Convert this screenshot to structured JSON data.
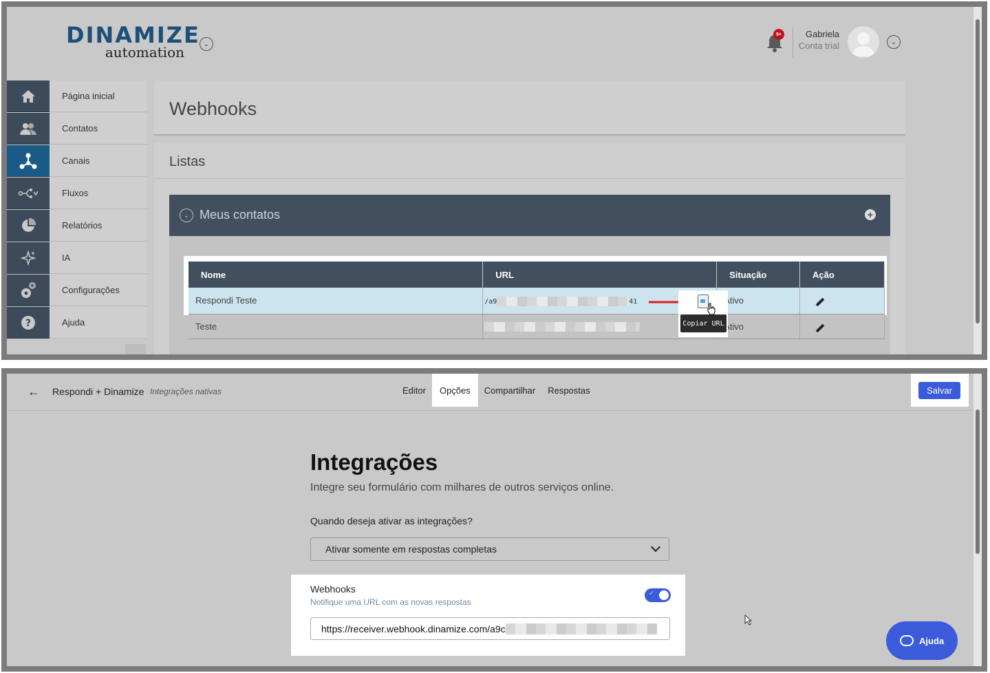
{
  "dinamize": {
    "logo_top": "DINAMIZE",
    "logo_bottom": "automation",
    "notification_badge": "9+",
    "user_name": "Gabriela",
    "user_plan": "Conta trial",
    "sidebar": [
      {
        "label": "Página inicial",
        "icon": "home-icon"
      },
      {
        "label": "Contatos",
        "icon": "contacts-icon"
      },
      {
        "label": "Canais",
        "icon": "channels-icon",
        "active": true
      },
      {
        "label": "Fluxos",
        "icon": "flows-icon"
      },
      {
        "label": "Relatórios",
        "icon": "reports-icon"
      },
      {
        "label": "IA",
        "icon": "ai-icon"
      },
      {
        "label": "Configurações",
        "icon": "settings-icon"
      },
      {
        "label": "Ajuda",
        "icon": "help-icon"
      }
    ],
    "page_title": "Webhooks",
    "section_title": "Listas",
    "group_title": "Meus contatos",
    "table": {
      "headers": [
        "Nome",
        "URL",
        "Situação",
        "Ação"
      ],
      "rows": [
        {
          "name": "Respondi Teste",
          "url_start": "/a9",
          "url_end": "41",
          "status": "Ativo"
        },
        {
          "name": "Teste",
          "url_start": "",
          "url_end": "",
          "status": "Ativo"
        }
      ]
    },
    "tooltip": "Copiar URL"
  },
  "respondi": {
    "title": "Respondi + Dinamize",
    "subtitle": "Integrações nativas",
    "tabs": [
      "Editor",
      "Opções",
      "Compartilhar",
      "Respostas"
    ],
    "active_tab": "Opções",
    "save_label": "Salvar",
    "heading": "Integrações",
    "description": "Integre seu formulário com milhares de outros serviços online.",
    "question": "Quando deseja ativar as integrações?",
    "select_value": "Ativar somente em respostas completas",
    "webhooks_title": "Webhooks",
    "webhooks_sub": "Notifique uma URL com as novas respostas",
    "webhook_url": "https://receiver.webhook.dinamize.com/a9c",
    "toggle_on": true,
    "help_label": "Ajuda",
    "accent": "#3b5bdb"
  }
}
